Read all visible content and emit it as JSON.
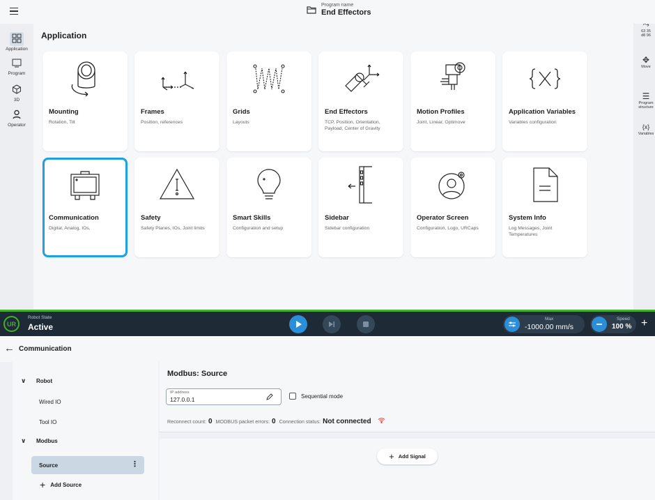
{
  "header": {
    "program_name_caption": "Program name",
    "program_name": "End Effectors"
  },
  "left_rail": {
    "items": [
      {
        "label": "Application",
        "icon": "grid-icon"
      },
      {
        "label": "Program",
        "icon": "monitor-icon"
      },
      {
        "label": "3D",
        "icon": "cube-icon"
      },
      {
        "label": "Operator",
        "icon": "person-icon"
      }
    ]
  },
  "right_rail": {
    "items": [
      {
        "label": "63 35",
        "sublabel": "d8 96",
        "icon": "connection-icon"
      },
      {
        "label": "Move",
        "icon": "move-icon"
      },
      {
        "label": "Program",
        "sublabel": "structure",
        "icon": "list-icon"
      },
      {
        "label": "Variables",
        "icon": "variables-icon"
      }
    ]
  },
  "application": {
    "title": "Application",
    "cards": [
      {
        "title": "Mounting",
        "subtitle": "Rotation, Tilt",
        "icon": "mounting-icon"
      },
      {
        "title": "Frames",
        "subtitle": "Position, references",
        "icon": "frames-icon"
      },
      {
        "title": "Grids",
        "subtitle": "Layouts",
        "icon": "grids-icon"
      },
      {
        "title": "End Effectors",
        "subtitle": "TCP, Position, Orientation, Payload, Center of Gravity",
        "icon": "end-effector-icon"
      },
      {
        "title": "Motion Profiles",
        "subtitle": "Joint, Linear, Optimove",
        "icon": "motion-profile-icon"
      },
      {
        "title": "Application Variables",
        "subtitle": "Variables configuration",
        "icon": "variables-icon"
      },
      {
        "title": "Communication",
        "subtitle": "Digital, Analog, IOs,",
        "icon": "control-box-icon",
        "selected": true
      },
      {
        "title": "Safety",
        "subtitle": "Safety Planes, IOs, Joint limits",
        "icon": "warning-icon"
      },
      {
        "title": "Smart Skills",
        "subtitle": "Configuration and setup",
        "icon": "lightbulb-icon"
      },
      {
        "title": "Sidebar",
        "subtitle": "Sidebar configuration",
        "icon": "sidebar-icon"
      },
      {
        "title": "Operator Screen",
        "subtitle": "Configuration, Logo, URCaps",
        "icon": "operator-screen-icon"
      },
      {
        "title": "System Info",
        "subtitle": "Log Messages, Joint Temperatures",
        "icon": "document-icon"
      }
    ]
  },
  "statebar": {
    "logo_text": "UR",
    "robot_state_label": "Robot State",
    "robot_state": "Active",
    "max_label": "Max",
    "max_value": "-1000.00 mm/s",
    "speed_label": "Speed",
    "speed_value": "100 %",
    "colors": {
      "active": "#43b02a",
      "accent": "#2c8ed6",
      "bar": "#1e2b36"
    }
  },
  "communication": {
    "title": "Communication",
    "tree": {
      "robot_label": "Robot",
      "wired_io": "Wired IO",
      "tool_io": "Tool IO",
      "modbus_label": "Modbus",
      "source": "Source",
      "add_source": "Add Source"
    },
    "source_panel": {
      "title": "Modbus: Source",
      "ip_label": "IP address",
      "ip_value": "127.0.0.1",
      "sequential_mode": "Sequential mode",
      "reconnect_label": "Reconnect count:",
      "reconnect_value": "0",
      "errors_label": "MODBUS packet errors:",
      "errors_value": "0",
      "status_label": "Connection status:",
      "status_value": "Not connected"
    },
    "add_signal": "Add Signal"
  }
}
